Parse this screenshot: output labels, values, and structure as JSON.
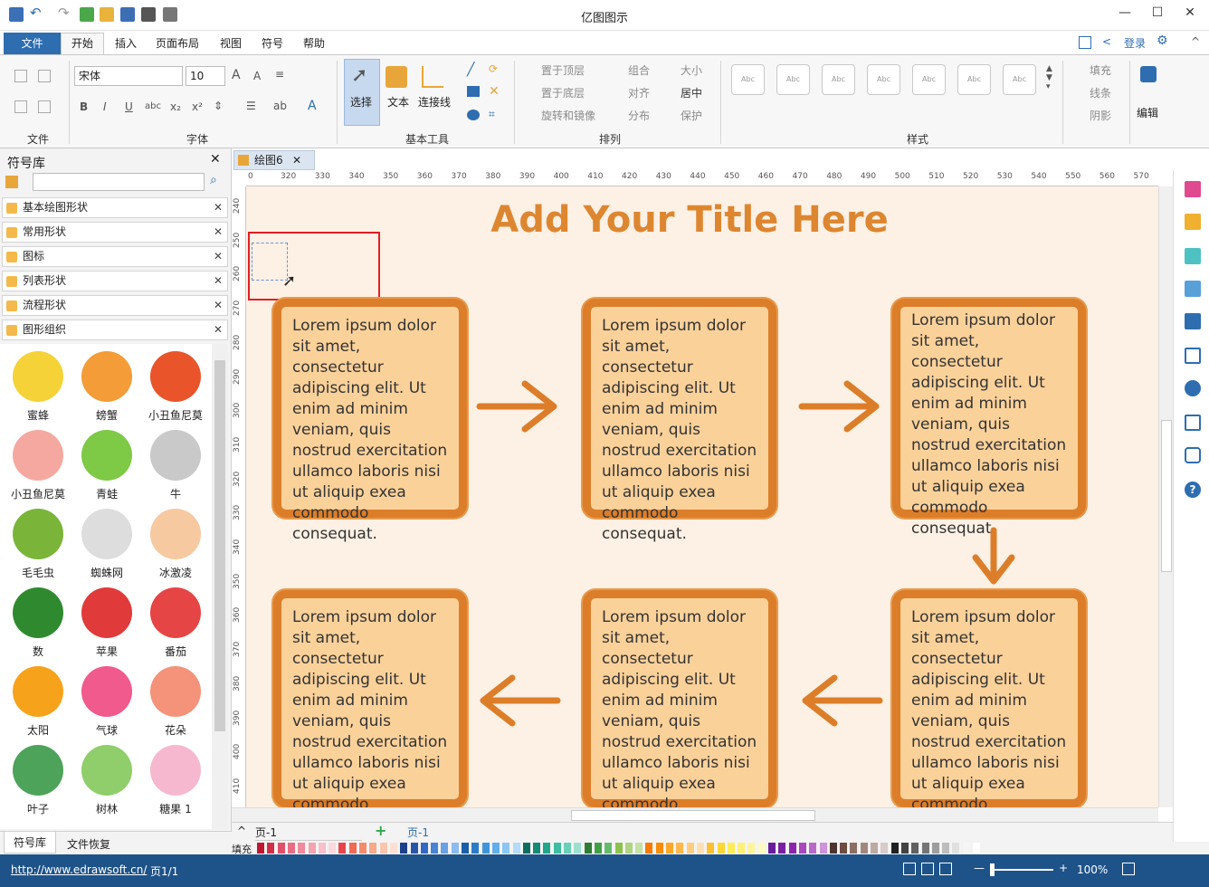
{
  "app": {
    "title": "亿图图示"
  },
  "window_controls": {
    "minimize": "—",
    "maximize": "☐",
    "close": "✕"
  },
  "menu": {
    "file": "文件",
    "tabs": [
      "开始",
      "插入",
      "页面布局",
      "视图",
      "符号",
      "帮助"
    ],
    "login": "登录"
  },
  "ribbon": {
    "groups": [
      "文件",
      "字体",
      "基本工具",
      "排列",
      "样式",
      "编辑"
    ],
    "font_name": "宋体",
    "font_size": "10",
    "tools": [
      "选择",
      "文本",
      "连接线"
    ],
    "arrange": [
      "置于顶层",
      "置于底层",
      "旋转和镜像",
      "组合",
      "对齐",
      "分布",
      "大小",
      "居中",
      "保护"
    ],
    "style_box_label": "Abc",
    "fill": [
      "填充",
      "线条",
      "阴影"
    ],
    "edit_label": "编辑"
  },
  "left_panel": {
    "title": "符号库",
    "libraries": [
      "基本绘图形状",
      "常用形状",
      "图标",
      "列表形状",
      "流程形状",
      "图形组织"
    ],
    "symbols": [
      {
        "label": "蜜蜂",
        "color": "#f5d237"
      },
      {
        "label": "螃蟹",
        "color": "#f39c38"
      },
      {
        "label": "小丑鱼尼莫",
        "color": "#e9542a"
      },
      {
        "label": "小丑鱼尼莫",
        "color": "#f5a8a0"
      },
      {
        "label": "青蛙",
        "color": "#7ec945"
      },
      {
        "label": "牛",
        "color": "#c9c9c9"
      },
      {
        "label": "毛毛虫",
        "color": "#7ab53a"
      },
      {
        "label": "蜘蛛网",
        "color": "#dddddd"
      },
      {
        "label": "冰激凌",
        "color": "#f6c9a0"
      },
      {
        "label": "数",
        "color": "#2f8a2f"
      },
      {
        "label": "苹果",
        "color": "#e03a3a"
      },
      {
        "label": "番茄",
        "color": "#e64545"
      },
      {
        "label": "太阳",
        "color": "#f7a21b"
      },
      {
        "label": "气球",
        "color": "#f05a8c"
      },
      {
        "label": "花朵",
        "color": "#f4937a"
      },
      {
        "label": "叶子",
        "color": "#4da35a"
      },
      {
        "label": "树林",
        "color": "#8fce6a"
      },
      {
        "label": "糖果 1",
        "color": "#f6b8cf"
      }
    ],
    "bottom_tabs": [
      "符号库",
      "文件恢复"
    ]
  },
  "document": {
    "tab": "绘图6",
    "ruler_h": [
      "0",
      "320",
      "330",
      "340",
      "350",
      "360",
      "370",
      "380",
      "390",
      "400",
      "410",
      "420",
      "430",
      "440",
      "450",
      "460",
      "470",
      "480",
      "490",
      "500",
      "510",
      "520",
      "530",
      "540",
      "550",
      "560",
      "570"
    ],
    "ruler_v": [
      "240",
      "250",
      "260",
      "270",
      "280",
      "290",
      "300",
      "310",
      "320",
      "330",
      "340",
      "350",
      "360",
      "370",
      "380",
      "390",
      "400",
      "410"
    ],
    "page_title": "Add Your Title Here",
    "card_text": "Lorem ipsum dolor sit amet, consectetur adipiscing elit. Ut enim ad minim veniam, quis nostrud exercitation ullamco laboris nisi ut aliquip exea commodo consequat."
  },
  "pages": {
    "current": "页-1",
    "tab": "页-1"
  },
  "color_bar": {
    "label": "填充"
  },
  "status": {
    "url": "http://www.edrawsoft.cn/",
    "page": "页1/1",
    "zoom": "100%"
  },
  "colors": {
    "accent": "#2e6db0",
    "status": "#1e5389",
    "card_border": "#dc7e29",
    "card_fill": "#fbd19a",
    "title": "#dd8630",
    "canvas": "#fdf0e4"
  }
}
